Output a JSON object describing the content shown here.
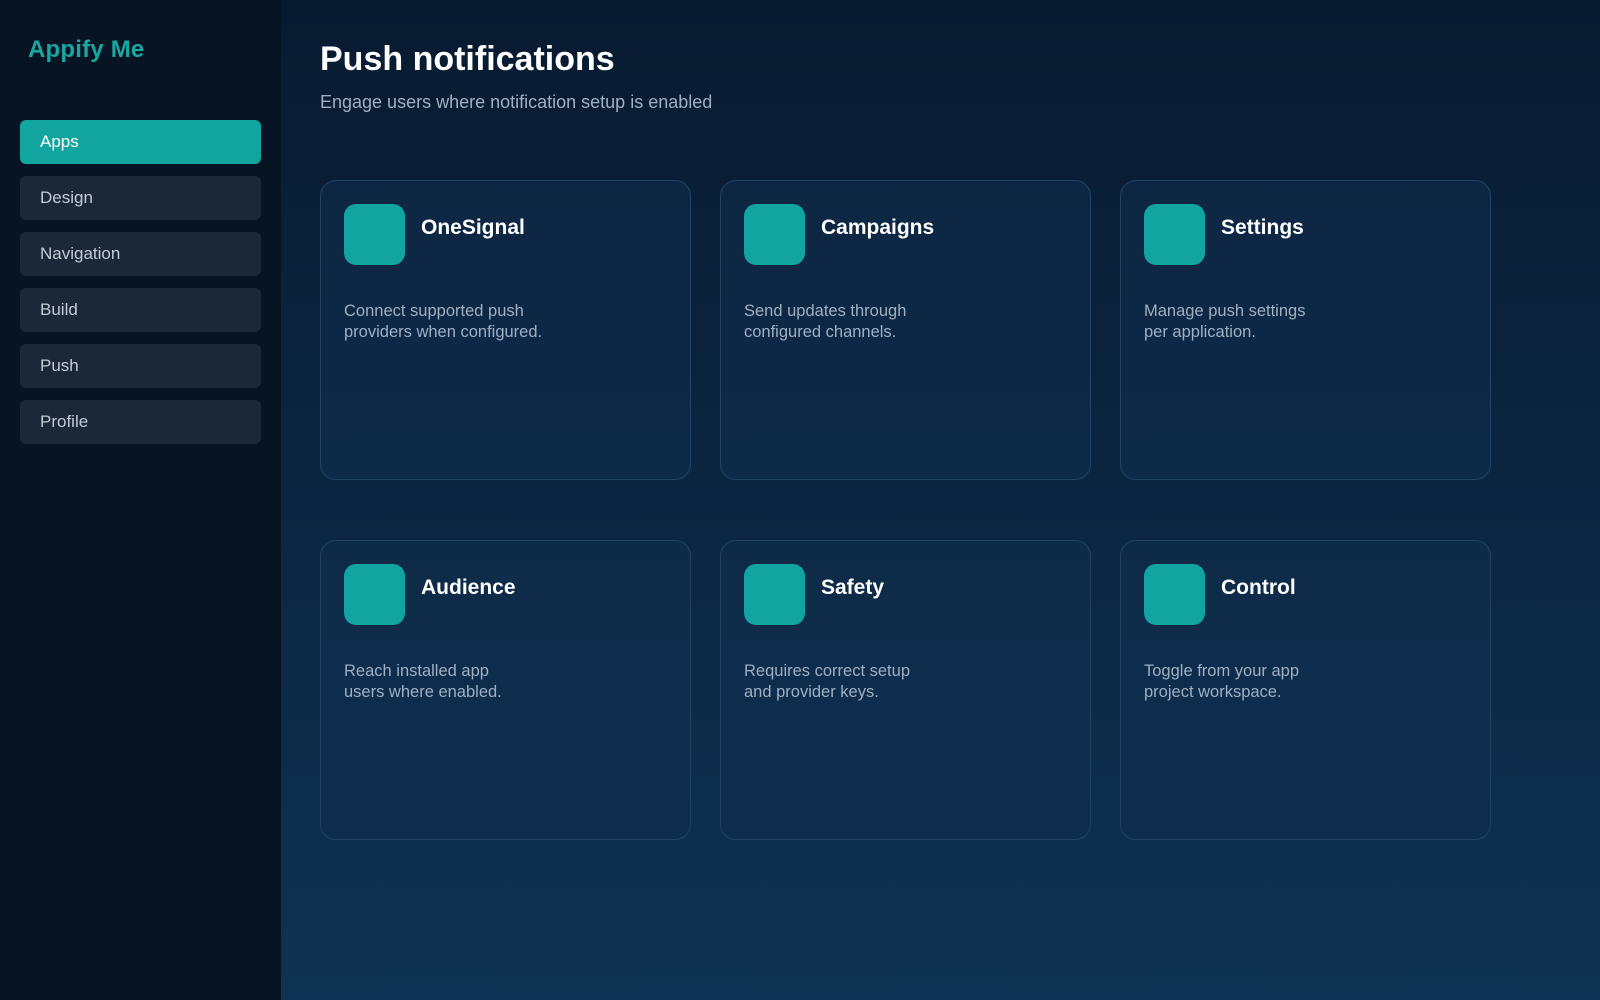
{
  "brand": "Appify Me",
  "colors": {
    "accent": "#12a5a0",
    "sidebar_bg": "#061424",
    "nav_bg": "#1c2738",
    "card_border": "#1f4563",
    "muted_text": "#9fb0c3"
  },
  "sidebar": {
    "items": [
      {
        "label": "Apps",
        "active": true
      },
      {
        "label": "Design",
        "active": false
      },
      {
        "label": "Navigation",
        "active": false
      },
      {
        "label": "Build",
        "active": false
      },
      {
        "label": "Push",
        "active": false
      },
      {
        "label": "Profile",
        "active": false
      }
    ]
  },
  "header": {
    "title": "Push notifications",
    "subtitle": "Engage users where notification setup is enabled"
  },
  "cards": [
    {
      "title": "OneSignal",
      "desc_line1": "Connect supported push",
      "desc_line2": "providers when configured."
    },
    {
      "title": "Campaigns",
      "desc_line1": "Send updates through",
      "desc_line2": "configured channels."
    },
    {
      "title": "Settings",
      "desc_line1": "Manage push settings",
      "desc_line2": "per application."
    },
    {
      "title": "Audience",
      "desc_line1": "Reach installed app",
      "desc_line2": "users where enabled."
    },
    {
      "title": "Safety",
      "desc_line1": "Requires correct setup",
      "desc_line2": "and provider keys."
    },
    {
      "title": "Control",
      "desc_line1": "Toggle from your app",
      "desc_line2": "project workspace."
    }
  ]
}
